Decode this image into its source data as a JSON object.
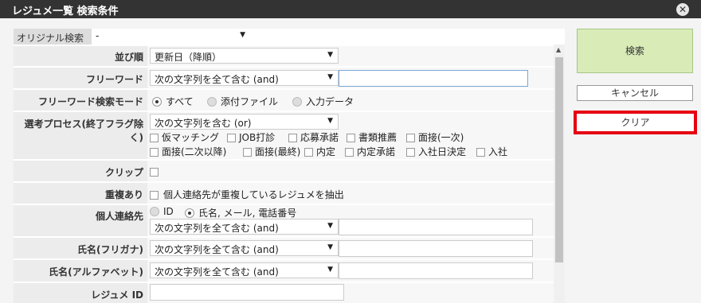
{
  "title": "レジュメ一覧 検索条件",
  "close_icon": "close-icon",
  "original_search": {
    "label": "オリジナル検索",
    "value": "-"
  },
  "rows": {
    "sort": {
      "label": "並び順",
      "value": "更新日（降順）"
    },
    "freeword": {
      "label": "フリーワード",
      "mode": "次の文字列を全て含む (and)",
      "value": ""
    },
    "freeword_mode": {
      "label": "フリーワード検索モード",
      "options": [
        "すべて",
        "添付ファイル",
        "入力データ"
      ],
      "selected": "すべて"
    },
    "process": {
      "label_line1": "選考プロセス(終了フラグ除",
      "label_line2": "く)",
      "mode": "次の文字列を含む (or)",
      "checkboxes": [
        "仮マッチング",
        "JOB打診",
        "応募承諾",
        "書類推薦",
        "面接(一次)",
        "面接(二次以降)",
        "面接(最終)",
        "内定",
        "内定承諾",
        "入社日決定",
        "入社"
      ]
    },
    "clip": {
      "label": "クリップ"
    },
    "duplicate": {
      "label": "重複あり",
      "text": "個人連絡先が重複しているレジュメを抽出"
    },
    "contact": {
      "label": "個人連絡先",
      "options": [
        "ID",
        "氏名, メール, 電話番号"
      ],
      "selected": "氏名, メール, 電話番号",
      "mode": "次の文字列を全て含む (and)"
    },
    "name_kana": {
      "label": "氏名(フリガナ)",
      "mode": "次の文字列を全て含む (and)"
    },
    "name_alpha": {
      "label": "氏名(アルファベット)",
      "mode": "次の文字列を全て含む (and)"
    },
    "resume_id": {
      "label": "レジュメ ID"
    }
  },
  "buttons": {
    "search": "検索",
    "cancel": "キャンセル",
    "clear": "クリア"
  },
  "colors": {
    "titlebar": "#333333",
    "search_button": "#d9ecb8",
    "highlight": "#e60012"
  }
}
